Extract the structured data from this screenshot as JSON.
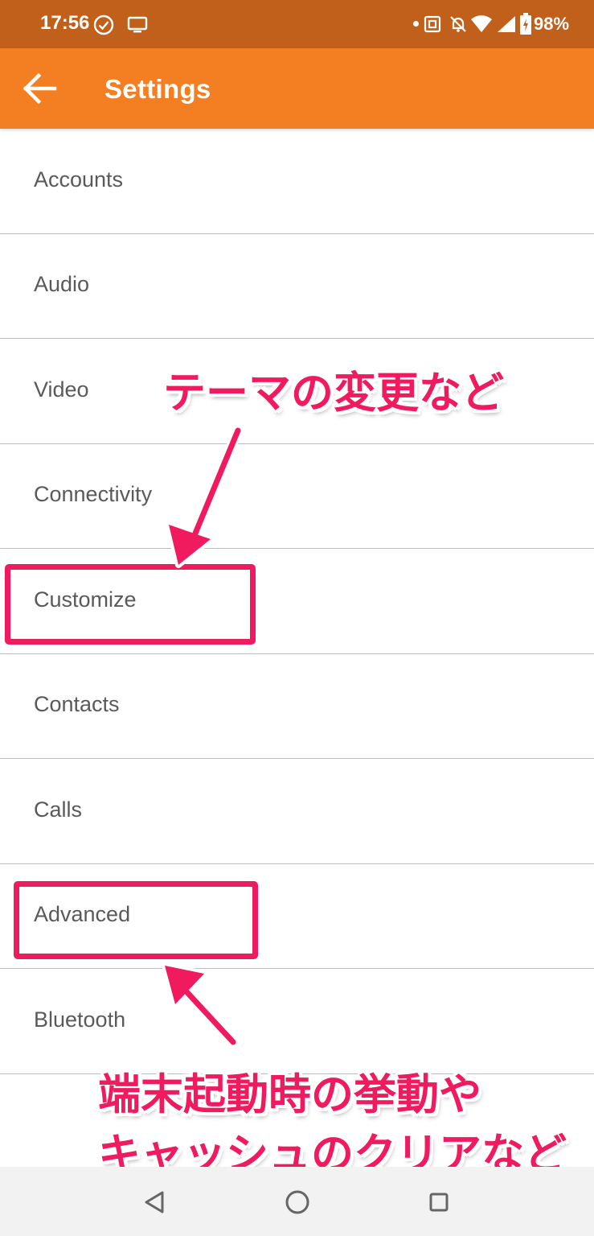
{
  "status_bar": {
    "time": "17:56",
    "battery_percent": "98%",
    "icons": [
      "check-circle-icon",
      "screen-cast-icon",
      "notification-dot",
      "nfc-icon",
      "bell-off-icon",
      "wifi-icon",
      "signal-icon",
      "battery-charging-icon"
    ]
  },
  "app_bar": {
    "title": "Settings",
    "back_icon": "arrow-left-icon",
    "color": "#f37f22"
  },
  "settings": {
    "items": [
      {
        "label": "Accounts"
      },
      {
        "label": "Audio"
      },
      {
        "label": "Video"
      },
      {
        "label": "Connectivity"
      },
      {
        "label": "Customize"
      },
      {
        "label": "Contacts"
      },
      {
        "label": "Calls"
      },
      {
        "label": "Advanced"
      },
      {
        "label": "Bluetooth"
      }
    ]
  },
  "annotations": {
    "color": "#f01a5e",
    "customize_note": "テーマの変更など",
    "advanced_note_line1": "端末起動時の挙動や",
    "advanced_note_line2": "キャッシュのクリアなど"
  },
  "nav_bar": {
    "buttons": [
      "back-triangle-icon",
      "home-circle-icon",
      "recents-square-icon"
    ]
  }
}
